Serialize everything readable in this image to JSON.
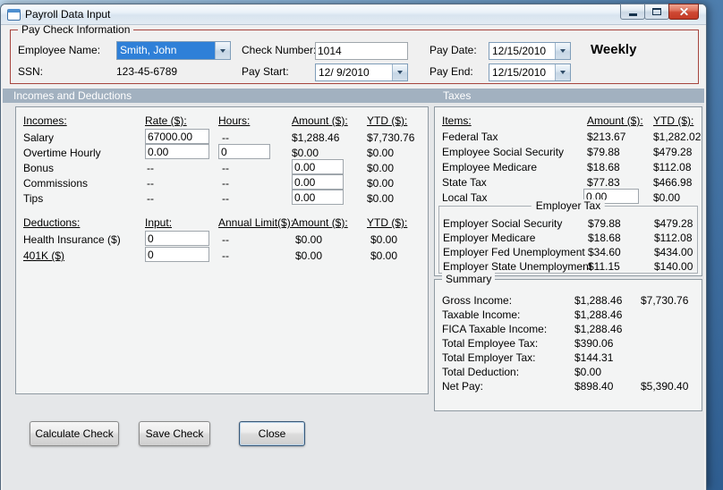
{
  "window": {
    "title": "Payroll Data Input"
  },
  "paycheck": {
    "legend": "Pay Check Information",
    "employee_label": "Employee Name:",
    "employee_value": "Smith, John",
    "ssn_label": "SSN:",
    "ssn_value": "123-45-6789",
    "check_label": "Check Number:",
    "check_value": "1014",
    "paystart_label": "Pay Start:",
    "paystart_value": "12/ 9/2010",
    "paydate_label": "Pay Date:",
    "paydate_value": "12/15/2010",
    "payend_label": "Pay End:",
    "payend_value": "12/15/2010",
    "frequency": "Weekly"
  },
  "sections": {
    "incomes": "Incomes and Deductions",
    "taxes": "Taxes"
  },
  "incomes": {
    "headers": {
      "name": "Incomes:",
      "rate": "Rate ($):",
      "hours": "Hours:",
      "amount": "Amount ($):",
      "ytd": "YTD ($):"
    },
    "salary": {
      "label": "Salary",
      "rate": "67000.00",
      "hours": "--",
      "amount": "$1,288.46",
      "ytd": "$7,730.76"
    },
    "overtime": {
      "label": "Overtime Hourly",
      "rate": "0.00",
      "hours": "0",
      "amount": "$0.00",
      "ytd": "$0.00"
    },
    "bonus": {
      "label": "Bonus",
      "rate": "--",
      "hours": "--",
      "amount": "0.00",
      "ytd": "$0.00"
    },
    "commissions": {
      "label": "Commissions",
      "rate": "--",
      "hours": "--",
      "amount": "0.00",
      "ytd": "$0.00"
    },
    "tips": {
      "label": "Tips",
      "rate": "--",
      "hours": "--",
      "amount": "0.00",
      "ytd": "$0.00"
    }
  },
  "deductions": {
    "headers": {
      "name": "Deductions:",
      "input": "Input:",
      "limit": "Annual Limit($):",
      "amount": "Amount ($):",
      "ytd": "YTD ($):"
    },
    "health": {
      "label": "Health Insurance  ($)",
      "input": "0",
      "limit": "--",
      "amount": "$0.00",
      "ytd": "$0.00"
    },
    "k401": {
      "label": "401K  ($)",
      "input": "0",
      "limit": "--",
      "amount": "$0.00",
      "ytd": "$0.00"
    }
  },
  "taxes": {
    "headers": {
      "items": "Items:",
      "amount": "Amount ($):",
      "ytd": "YTD ($):"
    },
    "federal": {
      "label": "Federal Tax",
      "amount": "$213.67",
      "ytd": "$1,282.02"
    },
    "emp_ss": {
      "label": "Employee Social Security",
      "amount": "$79.88",
      "ytd": "$479.28"
    },
    "emp_medicare": {
      "label": "Employee Medicare",
      "amount": "$18.68",
      "ytd": "$112.08"
    },
    "state": {
      "label": "State Tax",
      "amount": "$77.83",
      "ytd": "$466.98"
    },
    "local": {
      "label": "Local Tax",
      "amount": "0.00",
      "ytd": "$0.00"
    },
    "employer_legend": "Employer Tax",
    "employer_ss": {
      "label": "Employer Social Security",
      "amount": "$79.88",
      "ytd": "$479.28"
    },
    "employer_medicare": {
      "label": "Employer Medicare",
      "amount": "$18.68",
      "ytd": "$112.08"
    },
    "employer_fed": {
      "label": "Employer Fed Unemployment",
      "amount": "$34.60",
      "ytd": "$434.00"
    },
    "employer_state": {
      "label": "Employer State Unemployment",
      "amount": "$11.15",
      "ytd": "$140.00"
    }
  },
  "summary": {
    "legend": "Summary",
    "gross": {
      "label": "Gross Income:",
      "amount": "$1,288.46",
      "ytd": "$7,730.76"
    },
    "taxable": {
      "label": "Taxable Income:",
      "amount": "$1,288.46",
      "ytd": ""
    },
    "fica": {
      "label": "FICA Taxable Income:",
      "amount": "$1,288.46",
      "ytd": ""
    },
    "emp_tax": {
      "label": "Total Employee Tax:",
      "amount": "$390.06",
      "ytd": ""
    },
    "employer_tax": {
      "label": "Total Employer Tax:",
      "amount": "$144.31",
      "ytd": ""
    },
    "deduction": {
      "label": "Total Deduction:",
      "amount": "$0.00",
      "ytd": ""
    },
    "net": {
      "label": "Net Pay:",
      "amount": "$898.40",
      "ytd": "$5,390.40"
    }
  },
  "actions": {
    "calculate": "Calculate Check",
    "save": "Save Check",
    "close": "Close"
  }
}
